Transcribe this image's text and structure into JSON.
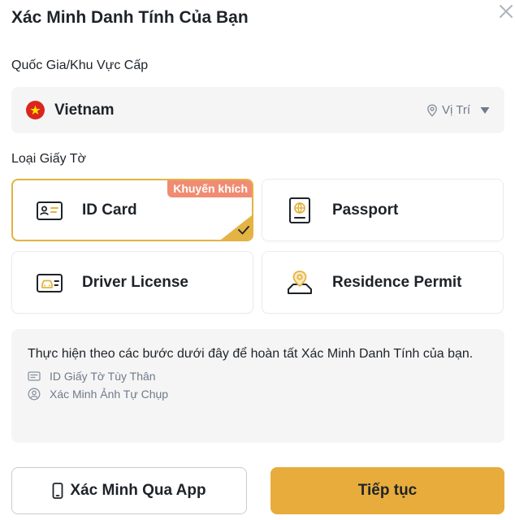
{
  "header": {
    "title": "Xác Minh Danh Tính Của Bạn",
    "close_icon": "close-icon"
  },
  "country_section": {
    "label": "Quốc Gia/Khu Vực Cấp",
    "selected_country": "Vietnam",
    "flag_icon": "vietnam-flag-icon",
    "location_label": "Vị Trí"
  },
  "document_section": {
    "label": "Loại Giấy Tờ",
    "options": [
      {
        "label": "ID Card",
        "icon": "id-card-icon",
        "selected": true,
        "badge": "Khuyến khích"
      },
      {
        "label": "Passport",
        "icon": "passport-icon",
        "selected": false
      },
      {
        "label": "Driver License",
        "icon": "driver-license-icon",
        "selected": false
      },
      {
        "label": "Residence Permit",
        "icon": "residence-permit-icon",
        "selected": false
      }
    ]
  },
  "steps": {
    "description": "Thực hiện theo các bước dưới đây để hoàn tất Xác Minh Danh Tính của bạn.",
    "items": [
      {
        "label": "ID Giấy Tờ Tùy Thân",
        "icon": "id-document-icon"
      },
      {
        "label": "Xác Minh Ảnh Tự Chụp",
        "icon": "selfie-icon"
      }
    ]
  },
  "actions": {
    "app_button": "Xác Minh Qua App",
    "next_button": "Tiếp tục"
  },
  "colors": {
    "accent": "#e8ac3c",
    "selected_border": "#e4b343",
    "badge": "#f08c73",
    "muted_text": "#707a8a",
    "panel_bg": "#f5f5f5"
  }
}
